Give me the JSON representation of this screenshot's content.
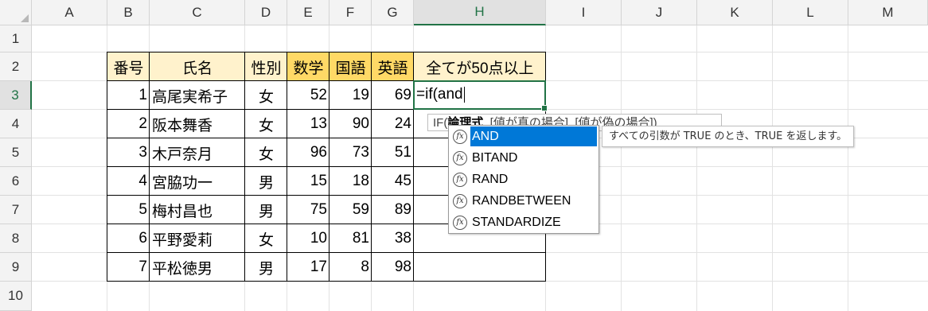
{
  "columns": [
    "A",
    "B",
    "C",
    "D",
    "E",
    "F",
    "G",
    "H",
    "I",
    "J",
    "K",
    "L",
    "M"
  ],
  "rows": [
    "1",
    "2",
    "3",
    "4",
    "5",
    "6",
    "7",
    "8",
    "9",
    "10"
  ],
  "active_column": "H",
  "active_row": "3",
  "table": {
    "headers": [
      "番号",
      "氏名",
      "性別",
      "数学",
      "国語",
      "英語",
      "全てが50点以上"
    ],
    "records": [
      {
        "no": "1",
        "name": "高尾実希子",
        "sex": "女",
        "math": "52",
        "jp": "19",
        "en": "69"
      },
      {
        "no": "2",
        "name": "阪本舞香",
        "sex": "女",
        "math": "13",
        "jp": "90",
        "en": "24"
      },
      {
        "no": "3",
        "name": "木戸奈月",
        "sex": "女",
        "math": "96",
        "jp": "73",
        "en": "51"
      },
      {
        "no": "4",
        "name": "宮脇功一",
        "sex": "男",
        "math": "15",
        "jp": "18",
        "en": "45"
      },
      {
        "no": "5",
        "name": "梅村昌也",
        "sex": "男",
        "math": "75",
        "jp": "59",
        "en": "89"
      },
      {
        "no": "6",
        "name": "平野愛莉",
        "sex": "女",
        "math": "10",
        "jp": "81",
        "en": "38"
      },
      {
        "no": "7",
        "name": "平松徳男",
        "sex": "男",
        "math": "17",
        "jp": "8",
        "en": "98"
      }
    ]
  },
  "editing_cell": {
    "ref": "H3",
    "formula": "=if(and"
  },
  "syntax_tooltip": {
    "func": "IF(",
    "arg_bold": "論理式",
    "rest": ", [値が真の場合], [値が偽の場合])"
  },
  "autocomplete": {
    "icon_symbol": "fx",
    "items": [
      "AND",
      "BITAND",
      "RAND",
      "RANDBETWEEN",
      "STANDARDIZE"
    ],
    "selected_index": 0,
    "description": "すべての引数が TRUE のとき、TRUE を返します。"
  },
  "colors": {
    "header_light_yellow": "#fff2cc",
    "header_gold": "#ffd966",
    "excel_green": "#217346",
    "selection_blue": "#0078d7"
  }
}
